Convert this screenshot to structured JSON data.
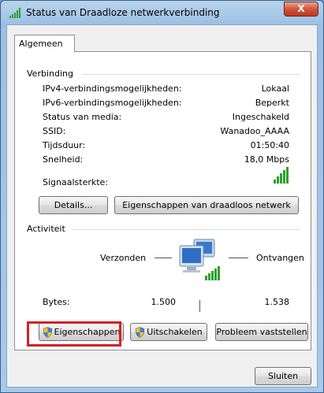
{
  "window": {
    "title": "Status van Draadloze netwerkverbinding",
    "close_label": "X"
  },
  "tab": {
    "label": "Algemeen"
  },
  "connection": {
    "group_title": "Verbinding",
    "rows": [
      {
        "label": "IPv4-verbindingsmogelijkheden:",
        "value": "Lokaal"
      },
      {
        "label": "IPv6-verbindingsmogelijkheden:",
        "value": "Beperkt"
      },
      {
        "label": "Status van media:",
        "value": "Ingeschakeld"
      },
      {
        "label": "SSID:",
        "value": "Wanadoo_AAAA"
      },
      {
        "label": "Tijdsduur:",
        "value": "01:50:40"
      },
      {
        "label": "Snelheid:",
        "value": "18,0 Mbps"
      }
    ],
    "signal_label": "Signaalsterkte:",
    "signal_bars": 5,
    "details_button": "Details...",
    "wireless_properties_button": "Eigenschappen van draadloos netwerk"
  },
  "activity": {
    "group_title": "Activiteit",
    "sent_label": "Verzonden",
    "received_label": "Ontvangen",
    "bytes_label": "Bytes:",
    "bytes_sent": "1.500",
    "bytes_received": "1.538"
  },
  "actions": {
    "properties_button": "Eigenschappen",
    "disable_button": "Uitschakelen",
    "diagnose_button": "Probleem vaststellen"
  },
  "footer": {
    "close_button": "Sluiten"
  },
  "colors": {
    "signal_green": "#2e9e2e",
    "highlight_red": "#d61f26"
  }
}
